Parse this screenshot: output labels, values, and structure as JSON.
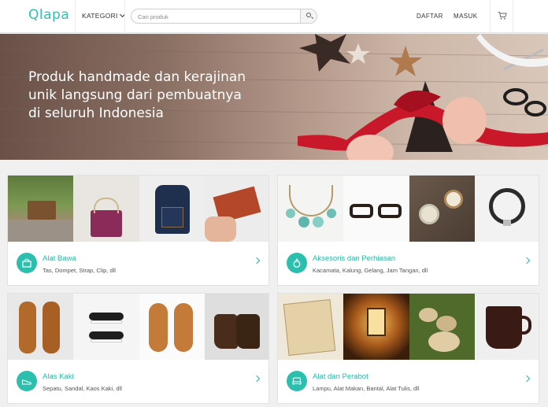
{
  "header": {
    "logo": "Qlapa",
    "kategori_label": "KATEGORI",
    "search_placeholder": "Cari produk",
    "daftar_label": "DAFTAR",
    "masuk_label": "MASUK",
    "accent_color": "#2dc1b3"
  },
  "banner": {
    "tagline_line1": "Produk handmade dan kerajinan",
    "tagline_line2": "unik langsung dari pembuatnya",
    "tagline_line3": "di seluruh Indonesia"
  },
  "categories": [
    {
      "title": "Alat Bawa",
      "subtitle": "Tas, Dompet, Strap, Clip, dll",
      "icon": "bag-icon"
    },
    {
      "title": "Aksesoris dan Perhiasan",
      "subtitle": "Kacamata, Kalung, Gelang, Jam Tangan, dll",
      "icon": "ring-icon"
    },
    {
      "title": "Alas Kaki",
      "subtitle": "Sepatu, Sandal, Kaos Kaki, dll",
      "icon": "shoe-icon"
    },
    {
      "title": "Alat dan Perabot",
      "subtitle": "Lampu, Alat Makan, Bantal, Alat Tulis, dll",
      "icon": "furniture-icon"
    }
  ]
}
